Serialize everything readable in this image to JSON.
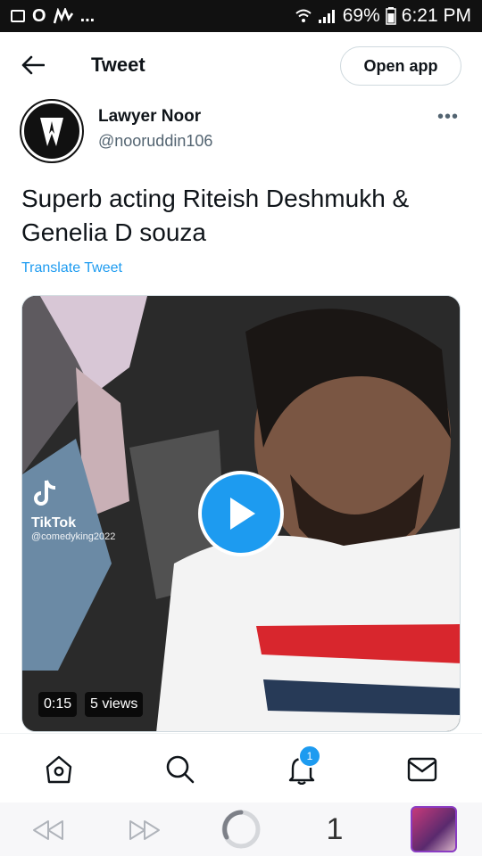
{
  "status_bar": {
    "left_letter": "O",
    "ellipsis": "...",
    "battery": "69%",
    "time": "6:21 PM"
  },
  "header": {
    "title": "Tweet",
    "open_app_label": "Open app"
  },
  "tweet": {
    "author_name": "Lawyer Noor",
    "author_handle": "@nooruddin106",
    "more_label": "•••",
    "text": "Superb acting Riteish Deshmukh & Genelia D souza",
    "translate_label": "Translate Tweet",
    "media": {
      "tiktok_label": "TikTok",
      "tiktok_handle": "@comedyking2022",
      "duration": "0:15",
      "views": "5 views"
    }
  },
  "tab_bar": {
    "notifications_badge": "1"
  },
  "browser_nav": {
    "tabs_count": "1"
  },
  "colors": {
    "accent": "#1d9bf0",
    "text_primary": "#0f1419",
    "text_secondary": "#536471"
  }
}
